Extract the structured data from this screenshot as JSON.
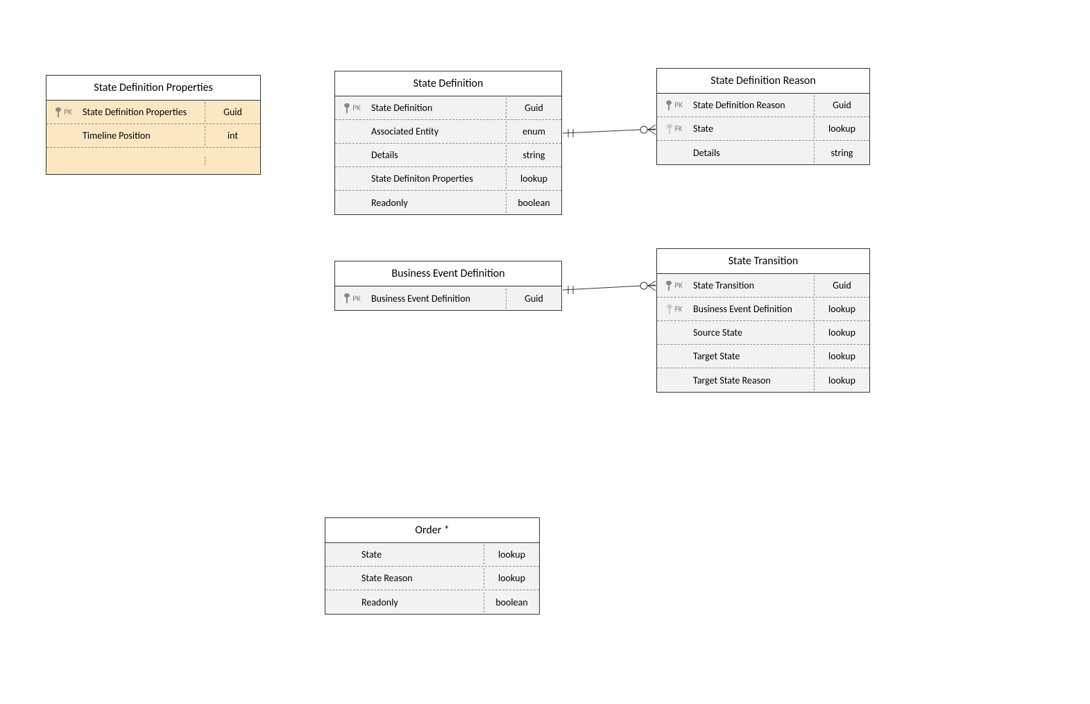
{
  "entities": {
    "sdp": {
      "title": "State Definition Properties",
      "rows": [
        {
          "key": "PK",
          "name": "State Definition Properties",
          "type": "Guid"
        },
        {
          "key": "",
          "name": "Timeline Position",
          "type": "int"
        }
      ]
    },
    "sd": {
      "title": "State Definition",
      "rows": [
        {
          "key": "PK",
          "name": "State Definition",
          "type": "Guid"
        },
        {
          "key": "",
          "name": "Associated Entity",
          "type": "enum"
        },
        {
          "key": "",
          "name": "Details",
          "type": "string"
        },
        {
          "key": "",
          "name": "State Definiton Properties",
          "type": "lookup"
        },
        {
          "key": "",
          "name": "Readonly",
          "type": "boolean"
        }
      ]
    },
    "sdr": {
      "title": "State Definition Reason",
      "rows": [
        {
          "key": "PK",
          "name": "State Definition Reason",
          "type": "Guid"
        },
        {
          "key": "FK",
          "name": "State",
          "type": "lookup"
        },
        {
          "key": "",
          "name": "Details",
          "type": "string"
        }
      ]
    },
    "bed": {
      "title": "Business Event Definition",
      "rows": [
        {
          "key": "PK",
          "name": "Business Event Definition",
          "type": "Guid"
        }
      ]
    },
    "st": {
      "title": "State Transition",
      "rows": [
        {
          "key": "PK",
          "name": "State Transition",
          "type": "Guid"
        },
        {
          "key": "FK",
          "name": "Business Event Definition",
          "type": "lookup"
        },
        {
          "key": "",
          "name": "Source State",
          "type": "lookup"
        },
        {
          "key": "",
          "name": "Target State",
          "type": "lookup"
        },
        {
          "key": "",
          "name": "Target State Reason",
          "type": "lookup"
        }
      ]
    },
    "order": {
      "title": "Order *",
      "rows": [
        {
          "key": "",
          "name": "State",
          "type": "lookup"
        },
        {
          "key": "",
          "name": "State Reason",
          "type": "lookup"
        },
        {
          "key": "",
          "name": "Readonly",
          "type": "boolean"
        }
      ]
    }
  },
  "relations": [
    {
      "from": "sd",
      "to": "sdr",
      "type": "one-to-many"
    },
    {
      "from": "bed",
      "to": "st",
      "type": "one-to-many"
    }
  ]
}
